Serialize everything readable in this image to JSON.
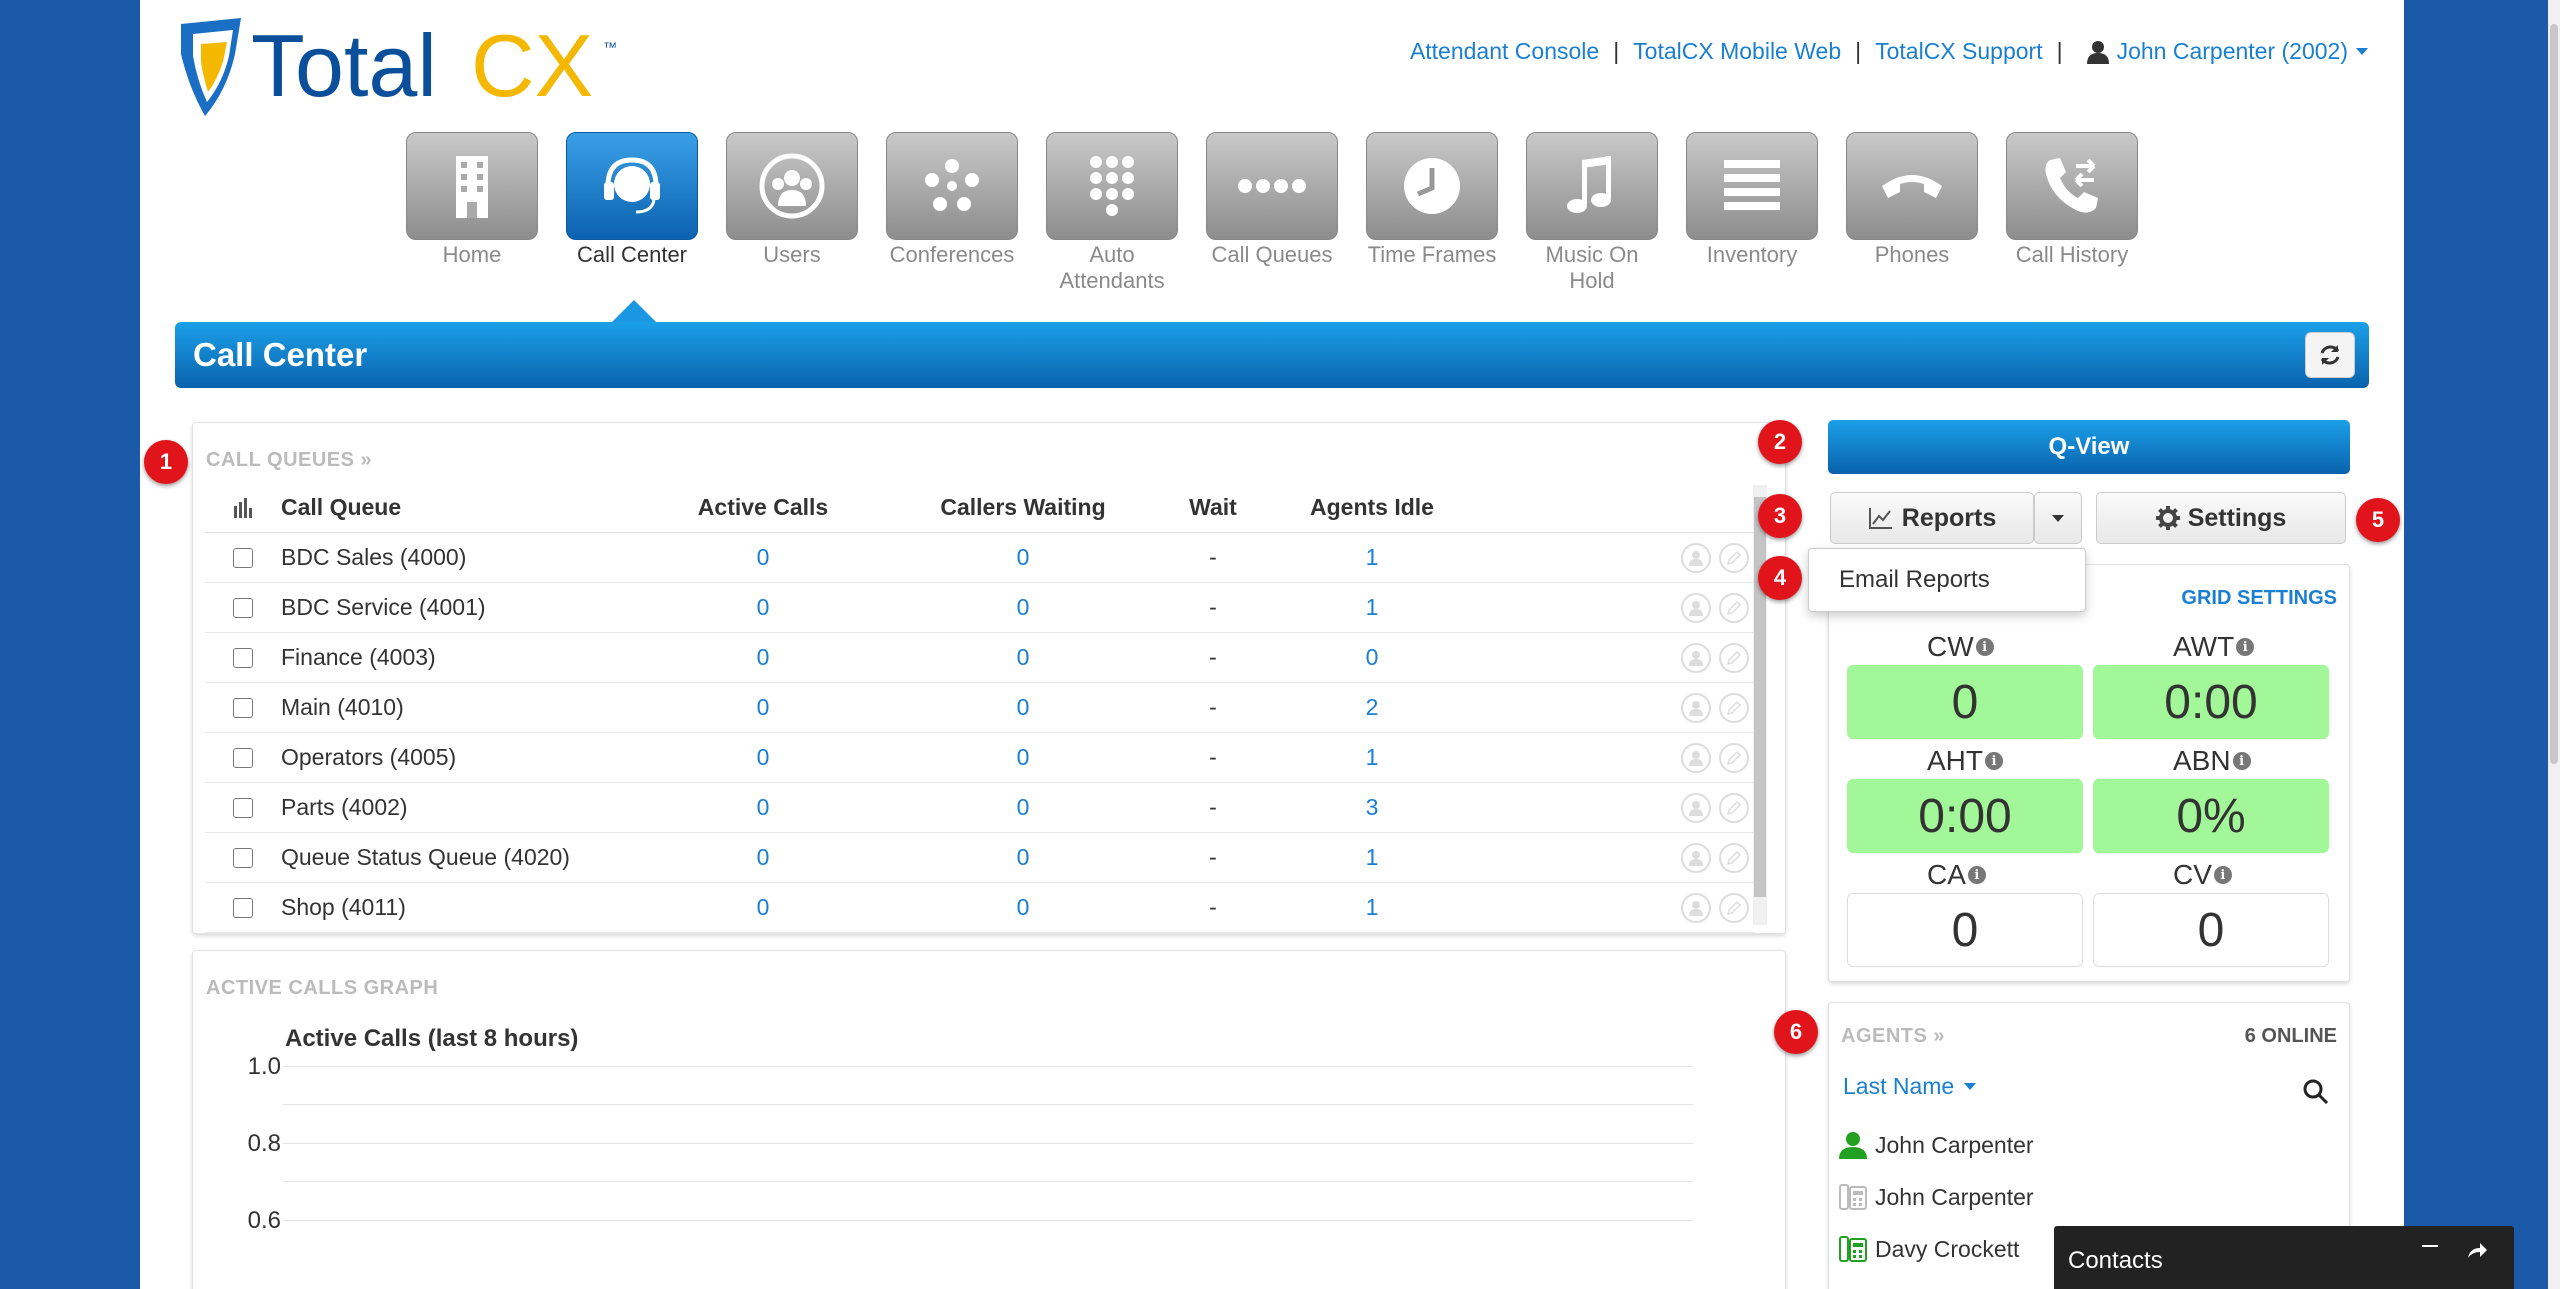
{
  "brand": {
    "name": "TotalCX",
    "tm": "™"
  },
  "top_links": {
    "attendant_console": "Attendant Console",
    "mobile_web": "TotalCX Mobile Web",
    "support": "TotalCX Support",
    "separator": "|",
    "user": "John Carpenter (2002)"
  },
  "nav": [
    {
      "label": "Home",
      "icon": "building-icon"
    },
    {
      "label": "Call Center",
      "icon": "headset-icon",
      "active": true
    },
    {
      "label": "Users",
      "icon": "users-icon"
    },
    {
      "label": "Conferences",
      "icon": "conference-icon"
    },
    {
      "label": "Auto Attendants",
      "icon": "keypad-icon"
    },
    {
      "label": "Call Queues",
      "icon": "dots-icon"
    },
    {
      "label": "Time Frames",
      "icon": "clock-icon"
    },
    {
      "label": "Music On Hold",
      "icon": "music-icon"
    },
    {
      "label": "Inventory",
      "icon": "list-icon"
    },
    {
      "label": "Phones",
      "icon": "phone-icon"
    },
    {
      "label": "Call History",
      "icon": "call-history-icon"
    }
  ],
  "page_title": "Call Center",
  "call_queues": {
    "heading": "CALL QUEUES »",
    "columns": [
      "Call Queue",
      "Active Calls",
      "Callers Waiting",
      "Wait",
      "Agents Idle"
    ],
    "rows": [
      {
        "name": "BDC Sales (4000)",
        "active": "0",
        "waiting": "0",
        "wait": "-",
        "idle": "1"
      },
      {
        "name": "BDC Service (4001)",
        "active": "0",
        "waiting": "0",
        "wait": "-",
        "idle": "1"
      },
      {
        "name": "Finance (4003)",
        "active": "0",
        "waiting": "0",
        "wait": "-",
        "idle": "0"
      },
      {
        "name": "Main (4010)",
        "active": "0",
        "waiting": "0",
        "wait": "-",
        "idle": "2"
      },
      {
        "name": "Operators (4005)",
        "active": "0",
        "waiting": "0",
        "wait": "-",
        "idle": "1"
      },
      {
        "name": "Parts (4002)",
        "active": "0",
        "waiting": "0",
        "wait": "-",
        "idle": "3"
      },
      {
        "name": "Queue Status Queue (4020)",
        "active": "0",
        "waiting": "0",
        "wait": "-",
        "idle": "1"
      },
      {
        "name": "Shop (4011)",
        "active": "0",
        "waiting": "0",
        "wait": "-",
        "idle": "1"
      }
    ]
  },
  "graph": {
    "heading": "ACTIVE CALLS GRAPH",
    "title": "Active Calls (last 8 hours)",
    "yticks": [
      "1.0",
      "0.8",
      "0.6"
    ]
  },
  "right": {
    "qview": "Q-View",
    "reports": "Reports",
    "email_reports": "Email Reports",
    "settings": "Settings",
    "grid_settings": "GRID SETTINGS",
    "stats": [
      {
        "label": "CW",
        "value": "0",
        "style": "green"
      },
      {
        "label": "AWT",
        "value": "0:00",
        "style": "green"
      },
      {
        "label": "AHT",
        "value": "0:00",
        "style": "green"
      },
      {
        "label": "ABN",
        "value": "0%",
        "style": "green"
      },
      {
        "label": "CA",
        "value": "0",
        "style": "plain"
      },
      {
        "label": "CV",
        "value": "0",
        "style": "plain"
      }
    ],
    "info_glyph": "i"
  },
  "agents": {
    "heading": "AGENTS »",
    "online": "6 ONLINE",
    "sort": "Last Name",
    "list": [
      {
        "name": "John Carpenter",
        "icon": "user-online-icon"
      },
      {
        "name": "John Carpenter",
        "icon": "desk-phone-idle-icon"
      },
      {
        "name": "Davy Crockett",
        "icon": "desk-phone-icon"
      }
    ]
  },
  "contacts": {
    "title": "Contacts"
  },
  "badges": [
    "1",
    "2",
    "3",
    "4",
    "5",
    "6"
  ],
  "colors": {
    "accent": "#1a7fd0",
    "header_blue": "#0a62ad",
    "stat_green": "#a2f898",
    "badge_red": "#e1141c",
    "page_bg": "#1a5aa8"
  }
}
